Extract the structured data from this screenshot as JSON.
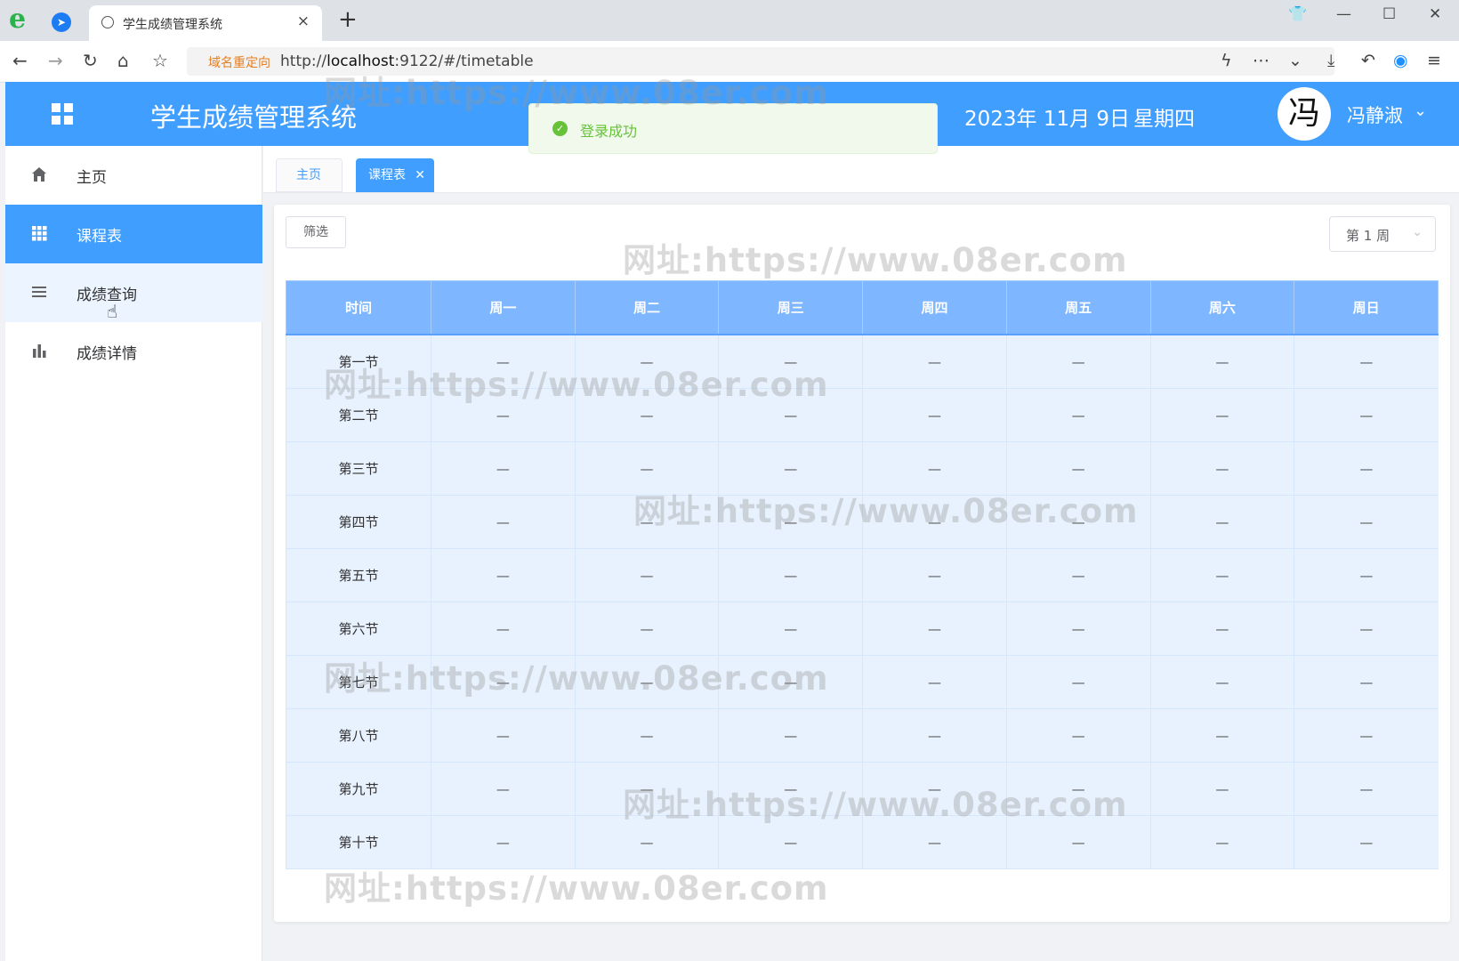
{
  "browser": {
    "tab_title": "学生成绩管理系统",
    "redirect_tag": "域名重定向",
    "url_prefix": "http://",
    "url_host": "localhost",
    "url_rest": ":9122/#/timetable"
  },
  "header": {
    "title": "学生成绩管理系统",
    "date": "2023年 11月 9日",
    "weekday": "星期四",
    "avatar_char": "冯",
    "user_name": "冯静淑"
  },
  "toast": {
    "message": "登录成功"
  },
  "sidebar": {
    "items": [
      {
        "label": "主页",
        "icon": "home-icon"
      },
      {
        "label": "课程表",
        "icon": "grid-icon",
        "active": true
      },
      {
        "label": "成绩查询",
        "icon": "list-icon",
        "hover": true
      },
      {
        "label": "成绩详情",
        "icon": "bar-chart-icon"
      }
    ]
  },
  "content_tabs": {
    "home": "主页",
    "current": "课程表"
  },
  "toolbar": {
    "filter_label": "筛选",
    "week_value": "第 1 周"
  },
  "timetable": {
    "headers": [
      "时间",
      "周一",
      "周二",
      "周三",
      "周四",
      "周五",
      "周六",
      "周日"
    ],
    "rows": [
      {
        "time": "第一节",
        "cells": [
          "—",
          "—",
          "—",
          "—",
          "—",
          "—",
          "—"
        ]
      },
      {
        "time": "第二节",
        "cells": [
          "—",
          "—",
          "—",
          "—",
          "—",
          "—",
          "—"
        ]
      },
      {
        "time": "第三节",
        "cells": [
          "—",
          "—",
          "—",
          "—",
          "—",
          "—",
          "—"
        ]
      },
      {
        "time": "第四节",
        "cells": [
          "—",
          "—",
          "—",
          "—",
          "—",
          "—",
          "—"
        ]
      },
      {
        "time": "第五节",
        "cells": [
          "—",
          "—",
          "—",
          "—",
          "—",
          "—",
          "—"
        ]
      },
      {
        "time": "第六节",
        "cells": [
          "—",
          "—",
          "—",
          "—",
          "—",
          "—",
          "—"
        ]
      },
      {
        "time": "第七节",
        "cells": [
          "—",
          "—",
          "—",
          "—",
          "—",
          "—",
          "—"
        ]
      },
      {
        "time": "第八节",
        "cells": [
          "—",
          "—",
          "—",
          "—",
          "—",
          "—",
          "—"
        ]
      },
      {
        "time": "第九节",
        "cells": [
          "—",
          "—",
          "—",
          "—",
          "—",
          "—",
          "—"
        ]
      },
      {
        "time": "第十节",
        "cells": [
          "—",
          "—",
          "—",
          "—",
          "—",
          "—",
          "—"
        ]
      }
    ]
  },
  "watermark": "网址:https://www.08er.com"
}
